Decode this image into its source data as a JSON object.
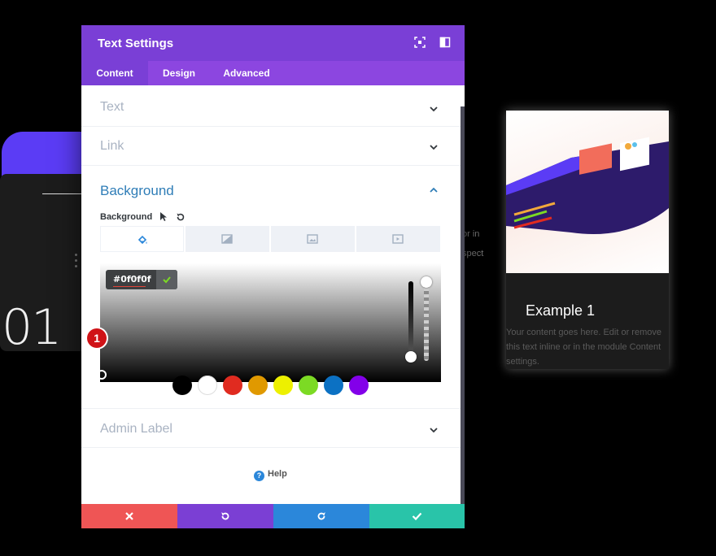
{
  "background": {
    "big_number": "01",
    "snippet_lines": [
      "or in",
      "spect"
    ],
    "example_card": {
      "title": "Example 1",
      "body": "Your content goes here. Edit or remove this text inline or in the module Content settings."
    }
  },
  "modal": {
    "title": "Text Settings",
    "header_icons": [
      "focus-icon",
      "split-view-icon"
    ],
    "tabs": [
      {
        "label": "Content",
        "active": true
      },
      {
        "label": "Design",
        "active": false
      },
      {
        "label": "Advanced",
        "active": false
      }
    ],
    "sections": {
      "text": "Text",
      "link": "Link",
      "background": "Background",
      "admin_label": "Admin Label"
    },
    "background_field": {
      "label": "Background",
      "type_tabs": [
        "color-fill-icon",
        "gradient-icon",
        "image-icon",
        "video-icon"
      ],
      "hex_value": "#0f0f0f",
      "marker": "1",
      "opacity_level": 1.0,
      "swatches": [
        "#000000",
        "#ffffff",
        "#e02b20",
        "#e09900",
        "#edf000",
        "#7cda24",
        "#0c71c3",
        "#8300e9"
      ]
    },
    "help_label": "Help",
    "footer": {
      "cancel_color": "#ef5555",
      "undo_color": "#7b3fd4",
      "redo_color": "#2b87da",
      "save_color": "#29c4a9"
    },
    "colors": {
      "header": "#7a3fd6",
      "tabs": "#8c46e0",
      "section_active": "#2f7db7",
      "section_inactive": "#a9b3c2"
    }
  }
}
